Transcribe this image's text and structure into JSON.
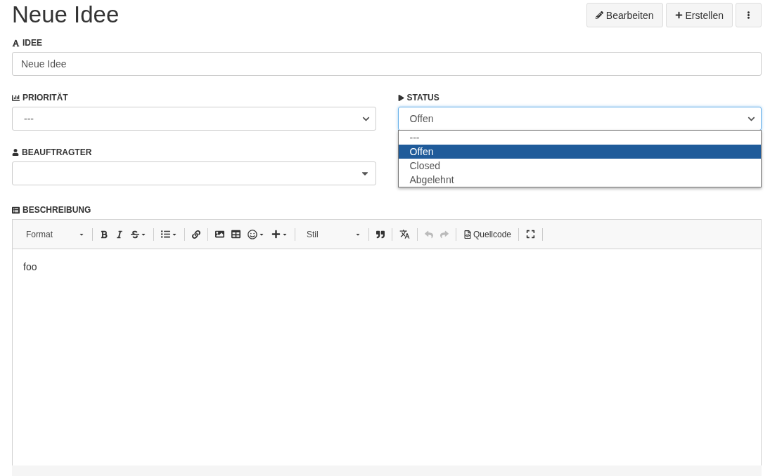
{
  "title": "Neue Idee",
  "header_buttons": [
    {
      "kind": "edit",
      "label": "Bearbeiten"
    },
    {
      "kind": "create",
      "label": "Erstellen"
    },
    {
      "kind": "more"
    }
  ],
  "idea": {
    "label": "IDEE",
    "value": "Neue Idee"
  },
  "priority": {
    "label": "PRIORITÄT",
    "value": "---"
  },
  "status": {
    "label": "STATUS",
    "value": "Offen",
    "open": true,
    "options": [
      {
        "label": "---",
        "selected": false
      },
      {
        "label": "Offen",
        "selected": true
      },
      {
        "label": "Closed",
        "selected": false
      },
      {
        "label": "Abgelehnt",
        "selected": false
      }
    ]
  },
  "assignee": {
    "label": "BEAUFTRAGTER"
  },
  "description": {
    "label": "BESCHREIBUNG",
    "content": "foo",
    "toolbar": {
      "format": "Format",
      "style": "Stil",
      "source": "Quellcode",
      "undo_disabled": true,
      "redo_disabled": true
    }
  }
}
